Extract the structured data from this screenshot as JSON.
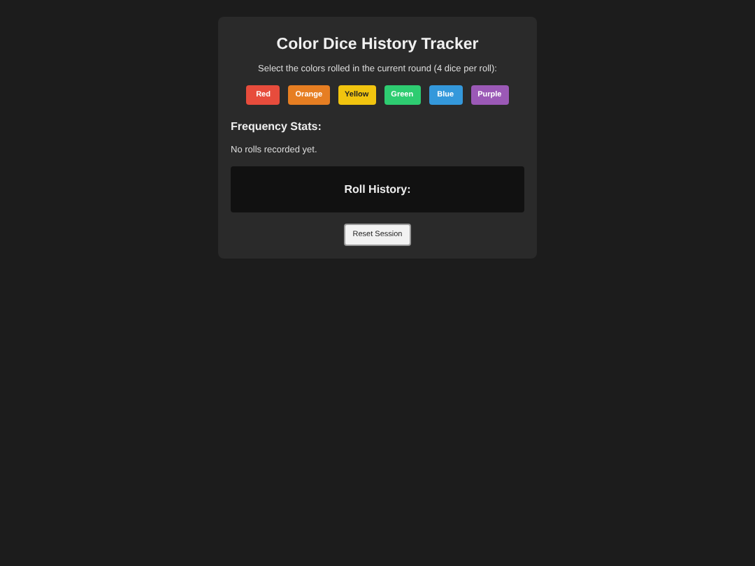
{
  "title": "Color Dice History Tracker",
  "instruction": "Select the colors rolled in the current round (4 dice per roll):",
  "colors": [
    {
      "label": "Red",
      "color": "#e74c3c"
    },
    {
      "label": "Orange",
      "color": "#e67e22"
    },
    {
      "label": "Yellow",
      "color": "#f1c40f"
    },
    {
      "label": "Green",
      "color": "#2ecc71"
    },
    {
      "label": "Blue",
      "color": "#3498db"
    },
    {
      "label": "Purple",
      "color": "#9b59b6"
    }
  ],
  "frequency": {
    "heading": "Frequency Stats:",
    "empty": "No rolls recorded yet."
  },
  "history": {
    "heading": "Roll History:"
  },
  "reset_button": "Reset Session"
}
